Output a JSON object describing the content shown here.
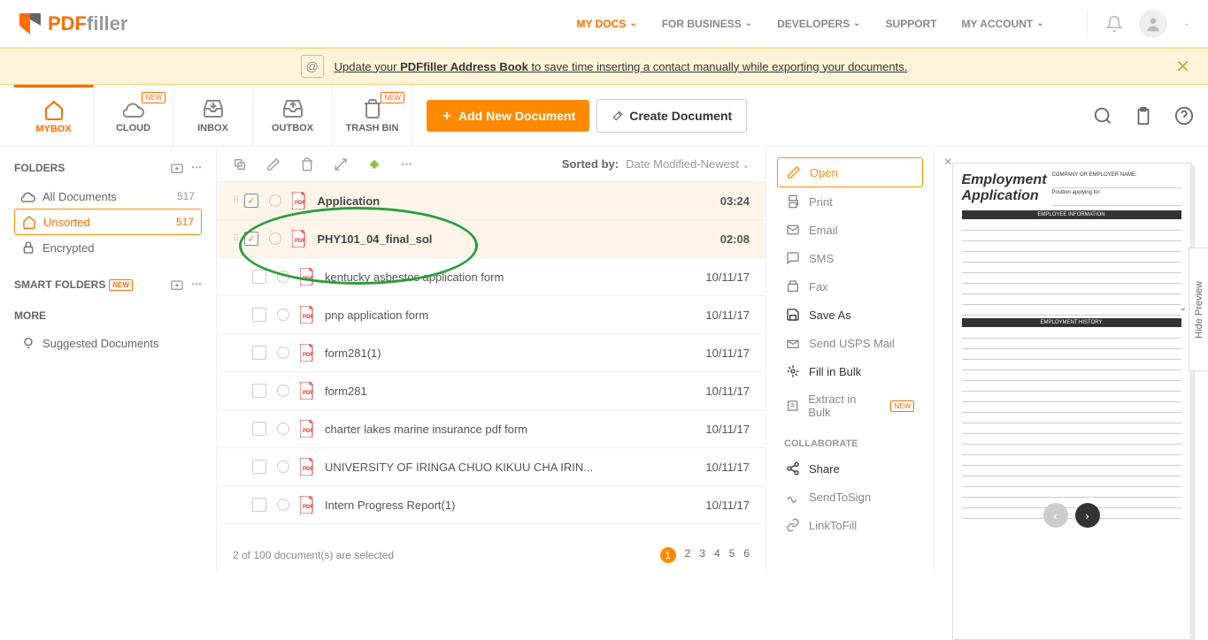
{
  "logo": {
    "text_pdf": "PDF",
    "text_filler": "filler"
  },
  "nav": {
    "mydocs": "MY DOCS",
    "business": "FOR BUSINESS",
    "developers": "DEVELOPERS",
    "support": "SUPPORT",
    "account": "MY ACCOUNT"
  },
  "banner": {
    "prefix": "Update your ",
    "bold": "PDFfiller Address Book",
    "suffix": " to save time inserting a contact manually while exporting your documents."
  },
  "tabs": {
    "mybox": "MYBOX",
    "cloud": "CLOUD",
    "inbox": "INBOX",
    "outbox": "OUTBOX",
    "trash": "TRASH BIN",
    "new": "NEW"
  },
  "buttons": {
    "add": "Add New Document",
    "create": "Create Document"
  },
  "sidebar": {
    "folders_heading": "FOLDERS",
    "all_docs": "All Documents",
    "all_count": "517",
    "unsorted": "Unsorted",
    "unsorted_count": "517",
    "encrypted": "Encrypted",
    "smart_heading": "SMART FOLDERS",
    "more_heading": "MORE",
    "suggested": "Suggested Documents"
  },
  "toolbar": {
    "sorted_by": "Sorted by:",
    "sort_value": "Date Modified-Newest"
  },
  "files": [
    {
      "name": "Application",
      "date": "03:24",
      "selected": true
    },
    {
      "name": "PHY101_04_final_sol",
      "date": "02:08",
      "selected": true
    },
    {
      "name": "kentucky asbestos application form",
      "date": "10/11/17",
      "selected": false
    },
    {
      "name": "pnp application form",
      "date": "10/11/17",
      "selected": false
    },
    {
      "name": "form281(1)",
      "date": "10/11/17",
      "selected": false
    },
    {
      "name": "form281",
      "date": "10/11/17",
      "selected": false
    },
    {
      "name": "charter lakes marine insurance pdf form",
      "date": "10/11/17",
      "selected": false
    },
    {
      "name": "UNIVERSITY OF IRINGA CHUO KIKUU CHA IRIN...",
      "date": "10/11/17",
      "selected": false
    },
    {
      "name": "Intern Progress Report(1)",
      "date": "10/11/17",
      "selected": false
    }
  ],
  "footer": {
    "status": "2 of 100 document(s) are selected",
    "pages": [
      "1",
      "2",
      "3",
      "4",
      "5",
      "6"
    ]
  },
  "actions": {
    "open": "Open",
    "print": "Print",
    "email": "Email",
    "sms": "SMS",
    "fax": "Fax",
    "saveas": "Save As",
    "usps": "Send USPS Mail",
    "fillbulk": "Fill in Bulk",
    "extractbulk": "Extract in Bulk",
    "collab": "COLLABORATE",
    "share": "Share",
    "sendtosign": "SendToSign",
    "linktofill": "LinkToFill"
  },
  "preview": {
    "title1": "Employment",
    "title2": "Application",
    "company": "COMPANY OR EMPLOYER NAME:",
    "position": "Position applying for:",
    "emp_info": "EMPLOYEE INFORMATION",
    "emp_hist": "EMPLOYMENT HISTORY",
    "hide": "Hide Preview"
  }
}
